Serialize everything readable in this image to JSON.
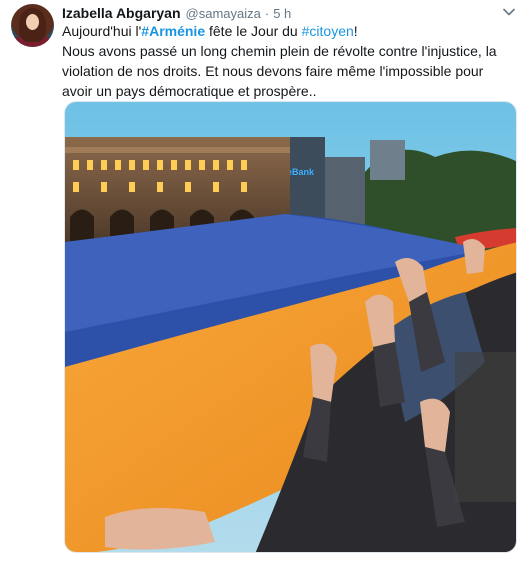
{
  "tweet": {
    "author_name": "Izabella Abgaryan",
    "author_handle": "@samayaiza",
    "separator": "·",
    "time": "5 h",
    "text_line1_before": "Aujourd'hui l'",
    "hashtag_armenie": "#Arménie",
    "text_line1_middle": " fête le Jour du ",
    "hashtag_citoyen": "#citoyen",
    "text_line1_end": "!",
    "text_body": "Nous avons passé un long chemin plein de révolte contre l'injustice, la violation de nos droits. Et nous devons faire même l'impossible pour avoir un pays démocratique et prospère..",
    "photo_sign_text": "ConverseBank"
  },
  "colors": {
    "hashtag": "#1b95e0",
    "flag_red": "#d63b2f",
    "flag_blue": "#2d50a8",
    "flag_orange": "#f59a2a"
  },
  "icons": {
    "menu": "chevron-down-icon"
  }
}
